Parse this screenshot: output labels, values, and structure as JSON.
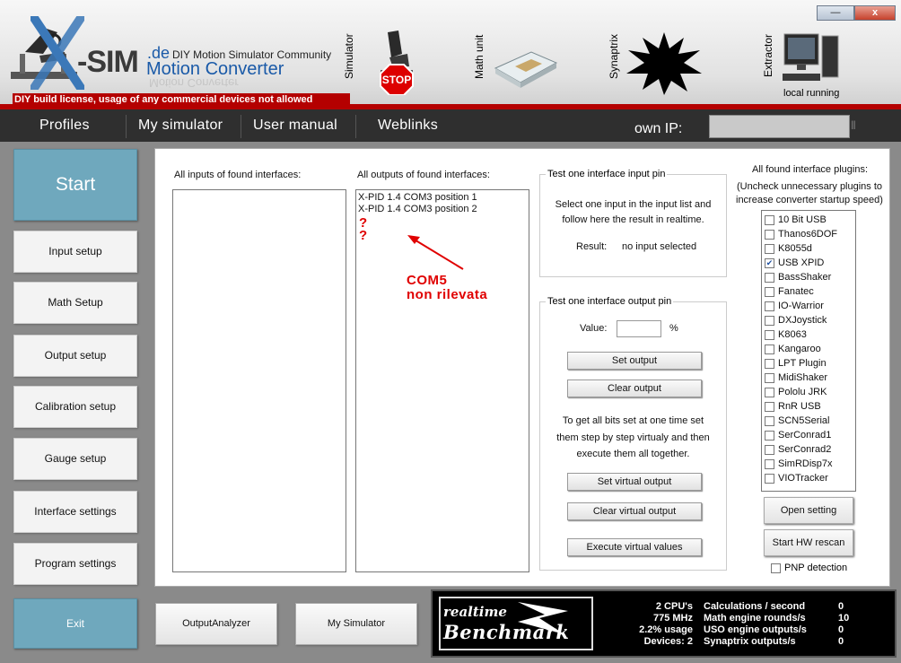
{
  "header": {
    "logo_sim": "-SIM",
    "logo_de": ".de",
    "logo_community": "DIY Motion Simulator Community",
    "logo_converter": "Motion Converter",
    "logo_mirror": "Motion Converter",
    "license": "DIY build license, usage of any commercial devices not allowed",
    "simulator_label": "Simulator",
    "stop_sign": "STOP",
    "math_label": "Math unit",
    "synaptrix_label": "Synaptrix",
    "extractor_label": "Extractor",
    "extractor_status": "local running",
    "minimize": "—",
    "close": "x"
  },
  "menu": {
    "profiles": "Profiles",
    "my_simulator": "My simulator",
    "user_manual": "User manual",
    "weblinks": "Weblinks",
    "own_ip_label": "own IP:",
    "grip": "|||"
  },
  "nav": {
    "start": "Start",
    "items": [
      "Input setup",
      "Math Setup",
      "Output setup",
      "Calibration setup",
      "Gauge setup",
      "Interface settings",
      "Program settings"
    ],
    "exit": "Exit"
  },
  "inputs": {
    "title": "All inputs of found interfaces:",
    "items": []
  },
  "outputs": {
    "title": "All outputs of found interfaces:",
    "items": [
      "X-PID 1.4 COM3 position 1",
      "X-PID 1.4 COM3 position 2"
    ],
    "q1": "?",
    "q2": "?",
    "annot_line1": "COM5",
    "annot_line2": "non rilevata"
  },
  "test_input": {
    "title": "Test one interface input pin",
    "line1": "Select one input in the input list and",
    "line2": "follow here the result in realtime.",
    "result_label": "Result:",
    "result_value": "no input selected"
  },
  "test_output": {
    "title": "Test one interface output pin",
    "value_label": "Value:",
    "value": "",
    "percent": "%",
    "set_output": "Set output",
    "clear_output": "Clear output",
    "line1": "To get all bits set at one time set",
    "line2": "them step by step virtualy and then",
    "line3": "execute them all together.",
    "set_virtual": "Set virtual output",
    "clear_virtual": "Clear virtual output",
    "execute_virtual": "Execute virtual values"
  },
  "plugins": {
    "title": "All found interface plugins:",
    "subtitle1": "(Uncheck unnecessary plugins to",
    "subtitle2": "increase converter startup speed)",
    "items": [
      {
        "name": "10 Bit USB",
        "checked": false
      },
      {
        "name": "Thanos6DOF",
        "checked": false
      },
      {
        "name": "K8055d",
        "checked": false
      },
      {
        "name": "USB XPID",
        "checked": true
      },
      {
        "name": "BassShaker",
        "checked": false
      },
      {
        "name": "Fanatec",
        "checked": false
      },
      {
        "name": "IO-Warrior",
        "checked": false
      },
      {
        "name": "DXJoystick",
        "checked": false
      },
      {
        "name": "K8063",
        "checked": false
      },
      {
        "name": "Kangaroo",
        "checked": false
      },
      {
        "name": "LPT Plugin",
        "checked": false
      },
      {
        "name": "MidiShaker",
        "checked": false
      },
      {
        "name": "Pololu JRK",
        "checked": false
      },
      {
        "name": "RnR USB",
        "checked": false
      },
      {
        "name": "SCN5Serial",
        "checked": false
      },
      {
        "name": "SerConrad1",
        "checked": false
      },
      {
        "name": "SerConrad2",
        "checked": false
      },
      {
        "name": "SimRDisp7x",
        "checked": false
      },
      {
        "name": "VIOTracker",
        "checked": false
      }
    ],
    "open_setting": "Open setting",
    "hw_rescan": "Start HW rescan",
    "pnp_label": "PNP detection",
    "pnp_checked": false
  },
  "bottom": {
    "output_analyzer": "OutputAnalyzer",
    "my_simulator": "My Simulator"
  },
  "benchmark": {
    "logo_top": "realtime",
    "logo_bottom": "Benchmark",
    "sys": [
      "2 CPU's",
      "775 MHz",
      "2.2% usage",
      "Devices: 2"
    ],
    "labels": [
      "Calculations / second",
      "Math engine rounds/s",
      "USO engine outputs/s",
      "Synaptrix outputs/s"
    ],
    "values": [
      "0",
      "10",
      "0",
      "0"
    ]
  }
}
